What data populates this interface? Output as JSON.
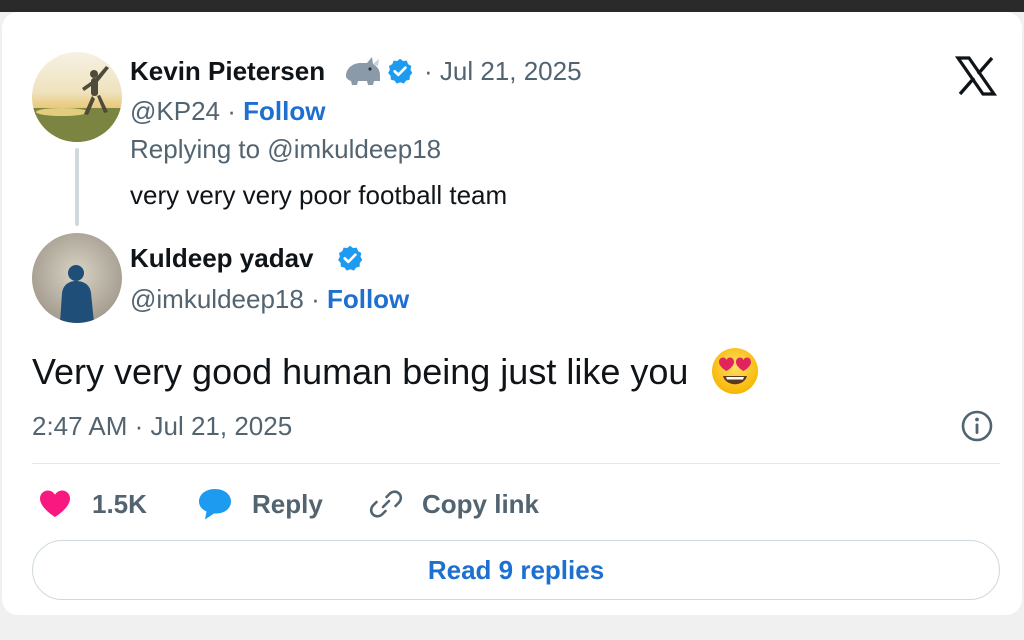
{
  "original_tweet": {
    "author_name": "Kevin Pietersen",
    "name_emoji_icon": "rhino-icon",
    "verified_icon": "verified-badge-icon",
    "date": "· Jul 21, 2025",
    "handle": "@KP24",
    "separator": "·",
    "follow_label": "Follow",
    "replying_to": "Replying to @imkuldeep18",
    "text": "very very very poor football team"
  },
  "reply_tweet": {
    "author_name": "Kuldeep yadav",
    "verified_icon": "verified-badge-icon",
    "handle": "@imkuldeep18",
    "separator": "·",
    "follow_label": "Follow",
    "text": "Very very good human being just like you",
    "text_emoji_icon": "heart-eyes-emoji-icon",
    "timestamp": "2:47 AM · Jul 21, 2025"
  },
  "actions": {
    "like_count": "1.5K",
    "reply_label": "Reply",
    "copy_link_label": "Copy link"
  },
  "read_replies_label": "Read 9 replies",
  "colors": {
    "link_blue": "#1d6fd0",
    "verified_blue": "#1d9bf0",
    "like_pink": "#f91880",
    "secondary_text": "#536471",
    "primary_text": "#0f1419"
  },
  "icons": {
    "brand": "x-logo-icon",
    "info": "info-icon",
    "like": "heart-icon",
    "reply": "speech-bubble-icon",
    "copy_link": "link-icon"
  }
}
